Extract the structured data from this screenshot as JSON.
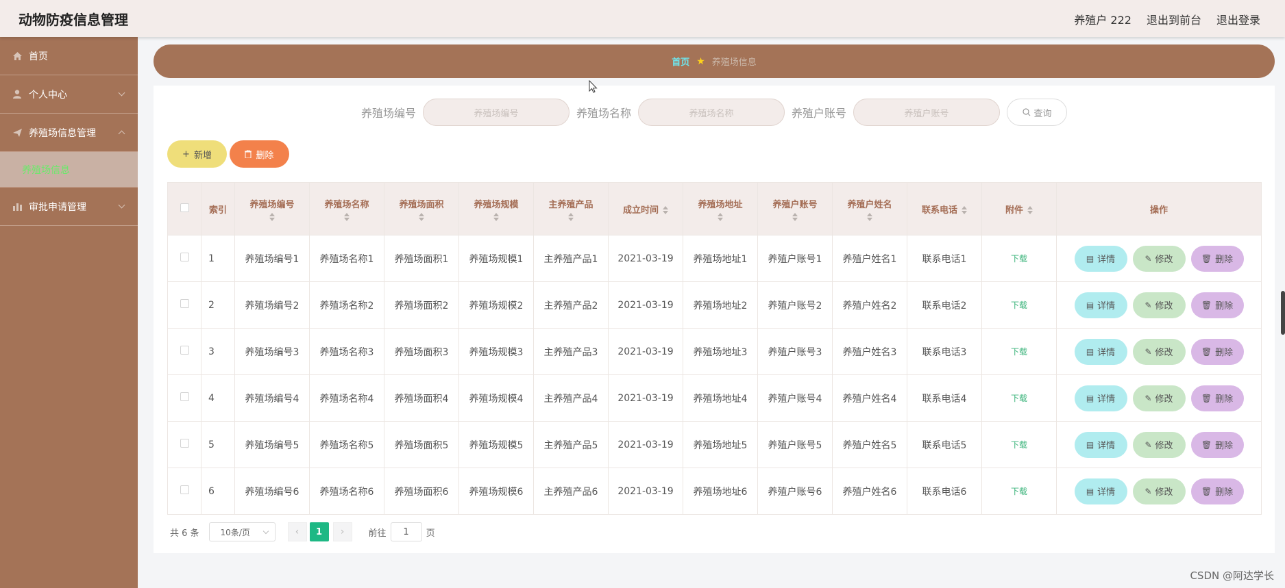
{
  "app": {
    "title": "动物防疫信息管理",
    "user": "养殖户 222",
    "to_front": "退出到前台",
    "logout": "退出登录"
  },
  "sidebar": {
    "items": [
      {
        "label": "首页",
        "icon": "home-icon"
      },
      {
        "label": "个人中心",
        "icon": "user-icon"
      },
      {
        "label": "养殖场信息管理",
        "icon": "send-icon"
      },
      {
        "label": "审批申请管理",
        "icon": "chart-icon"
      }
    ],
    "sub_active": "养殖场信息"
  },
  "breadcrumb": {
    "home": "首页",
    "current": "养殖场信息"
  },
  "search": {
    "f1_label": "养殖场编号",
    "f1_placeholder": "养殖场编号",
    "f2_label": "养殖场名称",
    "f2_placeholder": "养殖场名称",
    "f3_label": "养殖户账号",
    "f3_placeholder": "养殖户账号",
    "query": "查询"
  },
  "actions": {
    "add": "新增",
    "delete": "删除"
  },
  "table": {
    "headers": [
      "索引",
      "养殖场编号",
      "养殖场名称",
      "养殖场面积",
      "养殖场规模",
      "主养殖产品",
      "成立时间",
      "养殖场地址",
      "养殖户账号",
      "养殖户姓名",
      "联系电话",
      "附件",
      "操作"
    ],
    "rows": [
      [
        "1",
        "养殖场编号1",
        "养殖场名称1",
        "养殖场面积1",
        "养殖场规模1",
        "主养殖产品1",
        "2021-03-19",
        "养殖场地址1",
        "养殖户账号1",
        "养殖户姓名1",
        "联系电话1",
        "下载"
      ],
      [
        "2",
        "养殖场编号2",
        "养殖场名称2",
        "养殖场面积2",
        "养殖场规模2",
        "主养殖产品2",
        "2021-03-19",
        "养殖场地址2",
        "养殖户账号2",
        "养殖户姓名2",
        "联系电话2",
        "下载"
      ],
      [
        "3",
        "养殖场编号3",
        "养殖场名称3",
        "养殖场面积3",
        "养殖场规模3",
        "主养殖产品3",
        "2021-03-19",
        "养殖场地址3",
        "养殖户账号3",
        "养殖户姓名3",
        "联系电话3",
        "下载"
      ],
      [
        "4",
        "养殖场编号4",
        "养殖场名称4",
        "养殖场面积4",
        "养殖场规模4",
        "主养殖产品4",
        "2021-03-19",
        "养殖场地址4",
        "养殖户账号4",
        "养殖户姓名4",
        "联系电话4",
        "下载"
      ],
      [
        "5",
        "养殖场编号5",
        "养殖场名称5",
        "养殖场面积5",
        "养殖场规模5",
        "主养殖产品5",
        "2021-03-19",
        "养殖场地址5",
        "养殖户账号5",
        "养殖户姓名5",
        "联系电话5",
        "下载"
      ],
      [
        "6",
        "养殖场编号6",
        "养殖场名称6",
        "养殖场面积6",
        "养殖场规模6",
        "主养殖产品6",
        "2021-03-19",
        "养殖场地址6",
        "养殖户账号6",
        "养殖户姓名6",
        "联系电话6",
        "下载"
      ]
    ],
    "op_detail": "详情",
    "op_edit": "修改",
    "op_delete": "删除"
  },
  "pagination": {
    "total": "共 6 条",
    "page_size": "10条/页",
    "current_page": "1",
    "goto_label": "前往",
    "goto_value": "1",
    "goto_suffix": "页"
  },
  "watermark": "CSDN @阿达学长",
  "colors": {
    "brand": "#a47357",
    "add": "#efde7a",
    "delete": "#f3814b",
    "detail": "#b0ecef",
    "edit": "#c9e6c7",
    "remove": "#d9b8e6",
    "page_active": "#1db884"
  }
}
